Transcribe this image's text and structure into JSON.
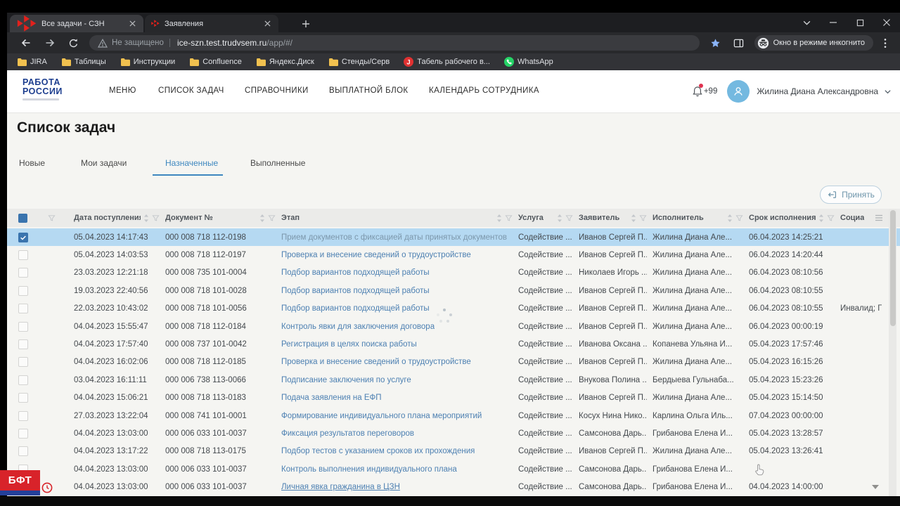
{
  "browser": {
    "tab_strip": {
      "tabs": [
        {
          "title": "Все задачи - СЗН",
          "favicon": "rabota-logo-icon",
          "active": true
        },
        {
          "title": "Заявления",
          "favicon": "rabota-logo-icon",
          "active": false
        }
      ]
    },
    "toolbar": {
      "security_label": "Не защищено",
      "url_host": "ice-szn.test.trudvsem.ru",
      "url_path": "/app/#/",
      "incognito_label": "Окно в режиме инкогнито"
    },
    "bookmarks": [
      {
        "label": "JIRA",
        "icon": "folder-icon"
      },
      {
        "label": "Таблицы",
        "icon": "folder-icon"
      },
      {
        "label": "Инструкции",
        "icon": "folder-icon"
      },
      {
        "label": "Confluence",
        "icon": "folder-icon"
      },
      {
        "label": "Яндекс.Диск",
        "icon": "folder-icon"
      },
      {
        "label": "Стенды/Серв",
        "icon": "folder-icon"
      },
      {
        "label": "Табель рабочего в...",
        "icon": "j-red-icon"
      },
      {
        "label": "WhatsApp",
        "icon": "whatsapp-icon"
      }
    ]
  },
  "app": {
    "logo": {
      "line1": "РАБОТА",
      "line2": "РОССИИ"
    },
    "nav": [
      {
        "label": "МЕНЮ"
      },
      {
        "label": "СПИСОК ЗАДАЧ"
      },
      {
        "label": "СПРАВОЧНИКИ"
      },
      {
        "label": "ВЫПЛАТНОЙ БЛОК"
      },
      {
        "label": "КАЛЕНДАРЬ СОТРУДНИКА"
      }
    ],
    "notifications": {
      "badge": "+99"
    },
    "user": {
      "name": "Жилина Диана Александровна"
    },
    "page_title": "Список задач",
    "tabs": [
      {
        "label": "Новые",
        "active": false
      },
      {
        "label": "Мои задачи",
        "active": false
      },
      {
        "label": "Назначенные",
        "active": true
      },
      {
        "label": "Выполненные",
        "active": false
      }
    ],
    "accept_button": {
      "label": "Принять",
      "icon": "accept-icon"
    }
  },
  "table": {
    "columns": [
      {
        "label": "",
        "type": "checkbox"
      },
      {
        "label": "",
        "type": "filter"
      },
      {
        "label": "Дата поступления",
        "sort": true,
        "filter": true
      },
      {
        "label": "Документ №",
        "sort": true,
        "filter": true
      },
      {
        "label": "Этап",
        "sort": true,
        "filter": true
      },
      {
        "label": "Услуга",
        "sort": true,
        "filter": true
      },
      {
        "label": "Заявитель",
        "sort": true,
        "filter": true
      },
      {
        "label": "Исполнитель",
        "sort": true,
        "filter": true
      },
      {
        "label": "Срок исполнения",
        "sort": true,
        "filter": true
      },
      {
        "label": "Социа",
        "type": "menu"
      }
    ],
    "rows": [
      {
        "checked": true,
        "selected": true,
        "date": "05.04.2023 14:17:43",
        "doc": "000 008 718 112-0198",
        "stage": "Прием документов с фиксацией даты принятых документов",
        "service": "Содействие ...",
        "applicant": "Иванов Сергей П...",
        "executor": "Жилина Диана Але...",
        "due": "06.04.2023 14:25:21",
        "social": ""
      },
      {
        "date": "05.04.2023 14:03:53",
        "doc": "000 008 718 112-0197",
        "stage": "Проверка и внесение сведений о трудоустройстве",
        "service": "Содействие ...",
        "applicant": "Иванов Сергей П...",
        "executor": "Жилина Диана Але...",
        "due": "06.04.2023 14:20:44",
        "social": ""
      },
      {
        "date": "23.03.2023 12:21:18",
        "doc": "000 008 735 101-0004",
        "stage": "Подбор вариантов подходящей работы",
        "service": "Содействие ...",
        "applicant": "Николаев Игорь ...",
        "executor": "Жилина Диана Але...",
        "due": "06.04.2023 08:10:56",
        "social": ""
      },
      {
        "date": "19.03.2023 22:40:56",
        "doc": "000 008 718 101-0028",
        "stage": "Подбор вариантов подходящей работы",
        "service": "Содействие ...",
        "applicant": "Иванов Сергей П...",
        "executor": "Жилина Диана Але...",
        "due": "06.04.2023 08:10:55",
        "social": ""
      },
      {
        "date": "22.03.2023 10:43:02",
        "doc": "000 008 718 101-0056",
        "stage": "Подбор вариантов подходящей работы",
        "service": "Содействие ...",
        "applicant": "Иванов Сергей П...",
        "executor": "Жилина Диана Але...",
        "due": "06.04.2023 08:10:55",
        "social": "Инвалид; Г"
      },
      {
        "date": "04.04.2023 15:55:47",
        "doc": "000 008 718 112-0184",
        "stage": "Контроль явки для заключения договора",
        "service": "Содействие ...",
        "applicant": "Иванов Сергей П...",
        "executor": "Жилина Диана Але...",
        "due": "06.04.2023 00:00:19",
        "social": ""
      },
      {
        "date": "04.04.2023 17:57:40",
        "doc": "000 008 737 101-0042",
        "stage": "Регистрация в целях поиска работы",
        "service": "Содействие ...",
        "applicant": "Иванова Оксана ...",
        "executor": "Копанева Ульяна И...",
        "due": "05.04.2023 17:57:46",
        "social": ""
      },
      {
        "date": "04.04.2023 16:02:06",
        "doc": "000 008 718 112-0185",
        "stage": "Проверка и внесение сведений о трудоустройстве",
        "service": "Содействие ...",
        "applicant": "Иванов Сергей П...",
        "executor": "Жилина Диана Але...",
        "due": "05.04.2023 16:15:26",
        "social": ""
      },
      {
        "date": "03.04.2023 16:11:11",
        "doc": "000 006 738 113-0066",
        "stage": "Подписание заключения по услуге",
        "service": "Содействие ...",
        "applicant": "Внукова Полина ...",
        "executor": "Бердыева Гульнаба...",
        "due": "05.04.2023 15:23:26",
        "social": ""
      },
      {
        "date": "04.04.2023 15:06:21",
        "doc": "000 008 718 113-0183",
        "stage": "Подача заявления на ЕФП",
        "service": "Содействие ...",
        "applicant": "Иванов Сергей П...",
        "executor": "Жилина Диана Але...",
        "due": "05.04.2023 15:14:50",
        "social": ""
      },
      {
        "date": "27.03.2023 13:22:04",
        "doc": "000 008 741 101-0001",
        "stage": "Формирование индивидуального плана мероприятий",
        "service": "Содействие ...",
        "applicant": "Косух Нина Нико...",
        "executor": "Карлина Ольга Иль...",
        "due": "07.04.2023 00:00:00",
        "social": ""
      },
      {
        "date": "04.04.2023 13:03:00",
        "doc": "000 006 033 101-0037",
        "stage": "Фиксация результатов переговоров",
        "service": "Содействие ...",
        "applicant": "Самсонова Дарь...",
        "executor": "Грибанова Елена И...",
        "due": "05.04.2023 13:28:57",
        "social": ""
      },
      {
        "date": "04.04.2023 13:17:22",
        "doc": "000 008 718 113-0175",
        "stage": "Подбор тестов с указанием сроков их прохождения",
        "service": "Содействие ...",
        "applicant": "Иванов Сергей П...",
        "executor": "Жилина Диана Але...",
        "due": "05.04.2023 13:26:41",
        "social": ""
      },
      {
        "date": "04.04.2023 13:03:00",
        "doc": "000 006 033 101-0037",
        "stage": "Контроль выполнения индивидуального плана",
        "service": "Содействие ...",
        "applicant": "Самсонова Дарь...",
        "executor": "Грибанова Елена И...",
        "due": "",
        "social": ""
      },
      {
        "date": "04.04.2023 13:03:00",
        "doc": "000 006 033 101-0037",
        "stage": "Личная явка гражданина в ЦЗН",
        "service": "Содействие ...",
        "applicant": "Самсонова Дарь...",
        "executor": "Грибанова Елена И...",
        "due": "04.04.2023 14:00:00",
        "social": ""
      }
    ]
  },
  "overlay": {
    "bft_label": "БФТ"
  },
  "colors": {
    "accent": "#3d87bf",
    "selected_row": "#b5d9f2",
    "link": "#4d80b2",
    "logo_red": "#e2211c",
    "logo_blue": "#1d3e8f",
    "bft_red": "#d8232a",
    "bft_blue": "#24409a",
    "avatar": "#74b9e0",
    "whatsapp": "#25d366",
    "chrome_dark": "#1d1e21"
  }
}
